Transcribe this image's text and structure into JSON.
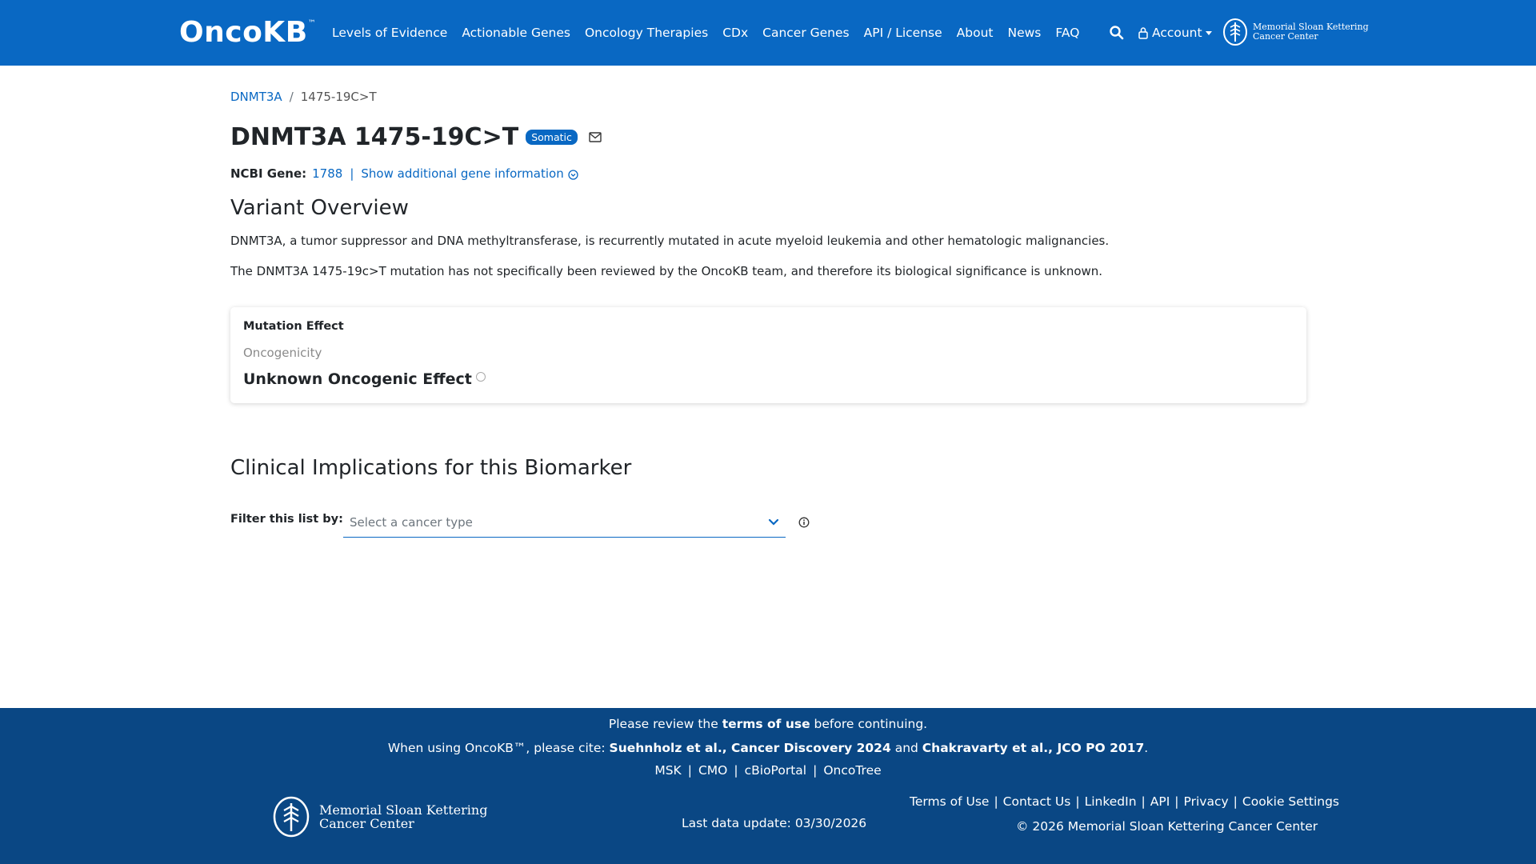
{
  "nav": {
    "logo": "OncoKB",
    "logo_tm": "™",
    "links": [
      "Levels of Evidence",
      "Actionable Genes",
      "Oncology Therapies",
      "CDx",
      "Cancer Genes",
      "API / License",
      "About",
      "News",
      "FAQ"
    ],
    "account": "Account",
    "msk_line1": "Memorial Sloan Kettering",
    "msk_line2": "Cancer Center"
  },
  "breadcrumb": {
    "gene": "DNMT3A",
    "separator": "/",
    "current": "1475-19C>T"
  },
  "title": {
    "text": "DNMT3A 1475-19C>T",
    "badge": "Somatic"
  },
  "gene_info": {
    "label": "NCBI Gene:",
    "id": "1788",
    "separator": "|",
    "more": "Show additional gene information"
  },
  "overview": {
    "heading": "Variant Overview",
    "p1": "DNMT3A, a tumor suppressor and DNA methyltransferase, is recurrently mutated in acute myeloid leukemia and other hematologic malignancies.",
    "p2": "The DNMT3A 1475-19c>T mutation has not specifically been reviewed by the OncoKB team, and therefore its biological significance is unknown."
  },
  "mutation_effect": {
    "label": "Mutation Effect",
    "sub": "Oncogenicity",
    "value": "Unknown Oncogenic Effect"
  },
  "clinical": {
    "heading": "Clinical Implications for this Biomarker",
    "filter_label": "Filter this list by:",
    "select_placeholder": "Select a cancer type"
  },
  "footer": {
    "review_pre": "Please review the ",
    "review_link": "terms of use",
    "review_post": " before continuing.",
    "cite_pre": "When using OncoKB™, please cite: ",
    "cite1": "Suehnholz et al., Cancer Discovery 2024",
    "cite_and": " and ",
    "cite2": "Chakravarty et al., JCO PO 2017",
    "cite_end": ".",
    "links": [
      "MSK",
      "CMO",
      "cBioPortal",
      "OncoTree"
    ],
    "msk_line1": "Memorial Sloan Kettering",
    "msk_line2": "Cancer Center",
    "last_update": "Last data update: 03/30/2026",
    "right_links": [
      "Terms of Use",
      "Contact Us",
      "LinkedIn",
      "API",
      "Privacy",
      "Cookie Settings"
    ],
    "copyright": "© 2026 Memorial Sloan Kettering Cancer Center"
  },
  "colors": {
    "brand": "#0968c3",
    "footer": "#0a4784"
  }
}
